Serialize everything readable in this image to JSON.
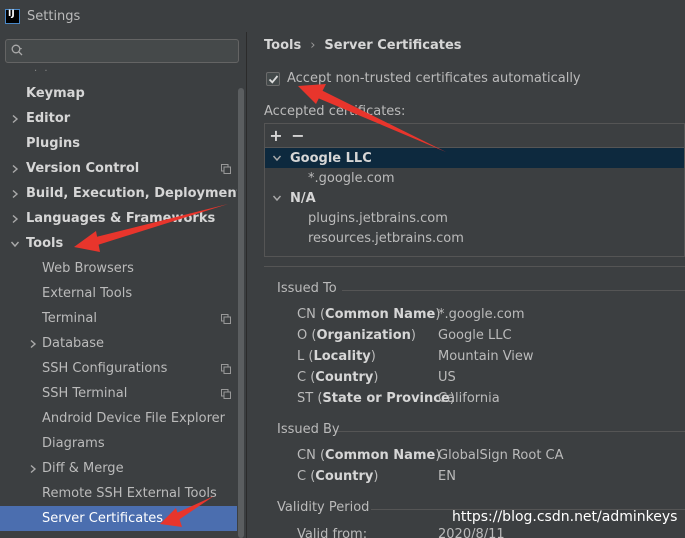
{
  "window": {
    "title": "Settings"
  },
  "search": {
    "placeholder": ""
  },
  "sidebar": {
    "items": [
      {
        "label": "Keymap",
        "bold": true,
        "arrow": "none",
        "copy": false
      },
      {
        "label": "Editor",
        "bold": true,
        "arrow": "right",
        "copy": false
      },
      {
        "label": "Plugins",
        "bold": true,
        "arrow": "none",
        "copy": false
      },
      {
        "label": "Version Control",
        "bold": true,
        "arrow": "right",
        "copy": true
      },
      {
        "label": "Build, Execution, Deployment",
        "bold": true,
        "arrow": "right",
        "copy": false
      },
      {
        "label": "Languages & Frameworks",
        "bold": true,
        "arrow": "right",
        "copy": false
      },
      {
        "label": "Tools",
        "bold": true,
        "arrow": "down",
        "copy": false
      },
      {
        "label": "Web Browsers",
        "bold": false,
        "arrow": "none",
        "copy": false
      },
      {
        "label": "External Tools",
        "bold": false,
        "arrow": "none",
        "copy": false
      },
      {
        "label": "Terminal",
        "bold": false,
        "arrow": "none",
        "copy": true
      },
      {
        "label": "Database",
        "bold": false,
        "arrow": "right",
        "copy": false
      },
      {
        "label": "SSH Configurations",
        "bold": false,
        "arrow": "none",
        "copy": true
      },
      {
        "label": "SSH Terminal",
        "bold": false,
        "arrow": "none",
        "copy": true
      },
      {
        "label": "Android Device File Explorer",
        "bold": false,
        "arrow": "none",
        "copy": false
      },
      {
        "label": "Diagrams",
        "bold": false,
        "arrow": "none",
        "copy": false
      },
      {
        "label": "Diff & Merge",
        "bold": false,
        "arrow": "right",
        "copy": false
      },
      {
        "label": "Remote SSH External Tools",
        "bold": false,
        "arrow": "none",
        "copy": false
      },
      {
        "label": "Server Certificates",
        "bold": false,
        "arrow": "none",
        "copy": false,
        "selected": true
      }
    ]
  },
  "main": {
    "breadcrumb": {
      "parent": "Tools",
      "separator": "›",
      "current": "Server Certificates"
    },
    "accept_checkbox": {
      "label": "Accept non-trusted certificates automatically",
      "checked": true
    },
    "accepted_label": "Accepted certificates:",
    "toolbar": {
      "add": "+",
      "remove": "−"
    },
    "certificates": [
      {
        "type": "group",
        "label": "Google LLC",
        "selected": true
      },
      {
        "type": "leaf",
        "label": "*.google.com"
      },
      {
        "type": "group",
        "label": "N/A",
        "selected": false
      },
      {
        "type": "leaf",
        "label": "plugins.jetbrains.com"
      },
      {
        "type": "leaf",
        "label": "resources.jetbrains.com"
      }
    ],
    "issued_to": {
      "title": "Issued To",
      "fields": [
        {
          "abbr": "CN",
          "name": "Common Name",
          "value": "*.google.com"
        },
        {
          "abbr": "O",
          "name": "Organization",
          "value": "Google LLC"
        },
        {
          "abbr": "L",
          "name": "Locality",
          "value": "Mountain View"
        },
        {
          "abbr": "C",
          "name": "Country",
          "value": "US"
        },
        {
          "abbr": "ST",
          "name": "State or Province",
          "value": "California"
        }
      ]
    },
    "issued_by": {
      "title": "Issued By",
      "fields": [
        {
          "abbr": "CN",
          "name": "Common Name",
          "value": "GlobalSign Root CA"
        },
        {
          "abbr": "C",
          "name": "Country",
          "value": "EN"
        }
      ]
    },
    "validity": {
      "title": "Validity Period",
      "fields": [
        {
          "label": "Valid from:",
          "value": "2020/8/11"
        }
      ]
    }
  },
  "watermark": "https://blog.csdn.net/adminkeys",
  "colors": {
    "selection": "#4b6eaf",
    "tree_selection": "#0d293e",
    "annotation_arrow": "#e8352c"
  }
}
